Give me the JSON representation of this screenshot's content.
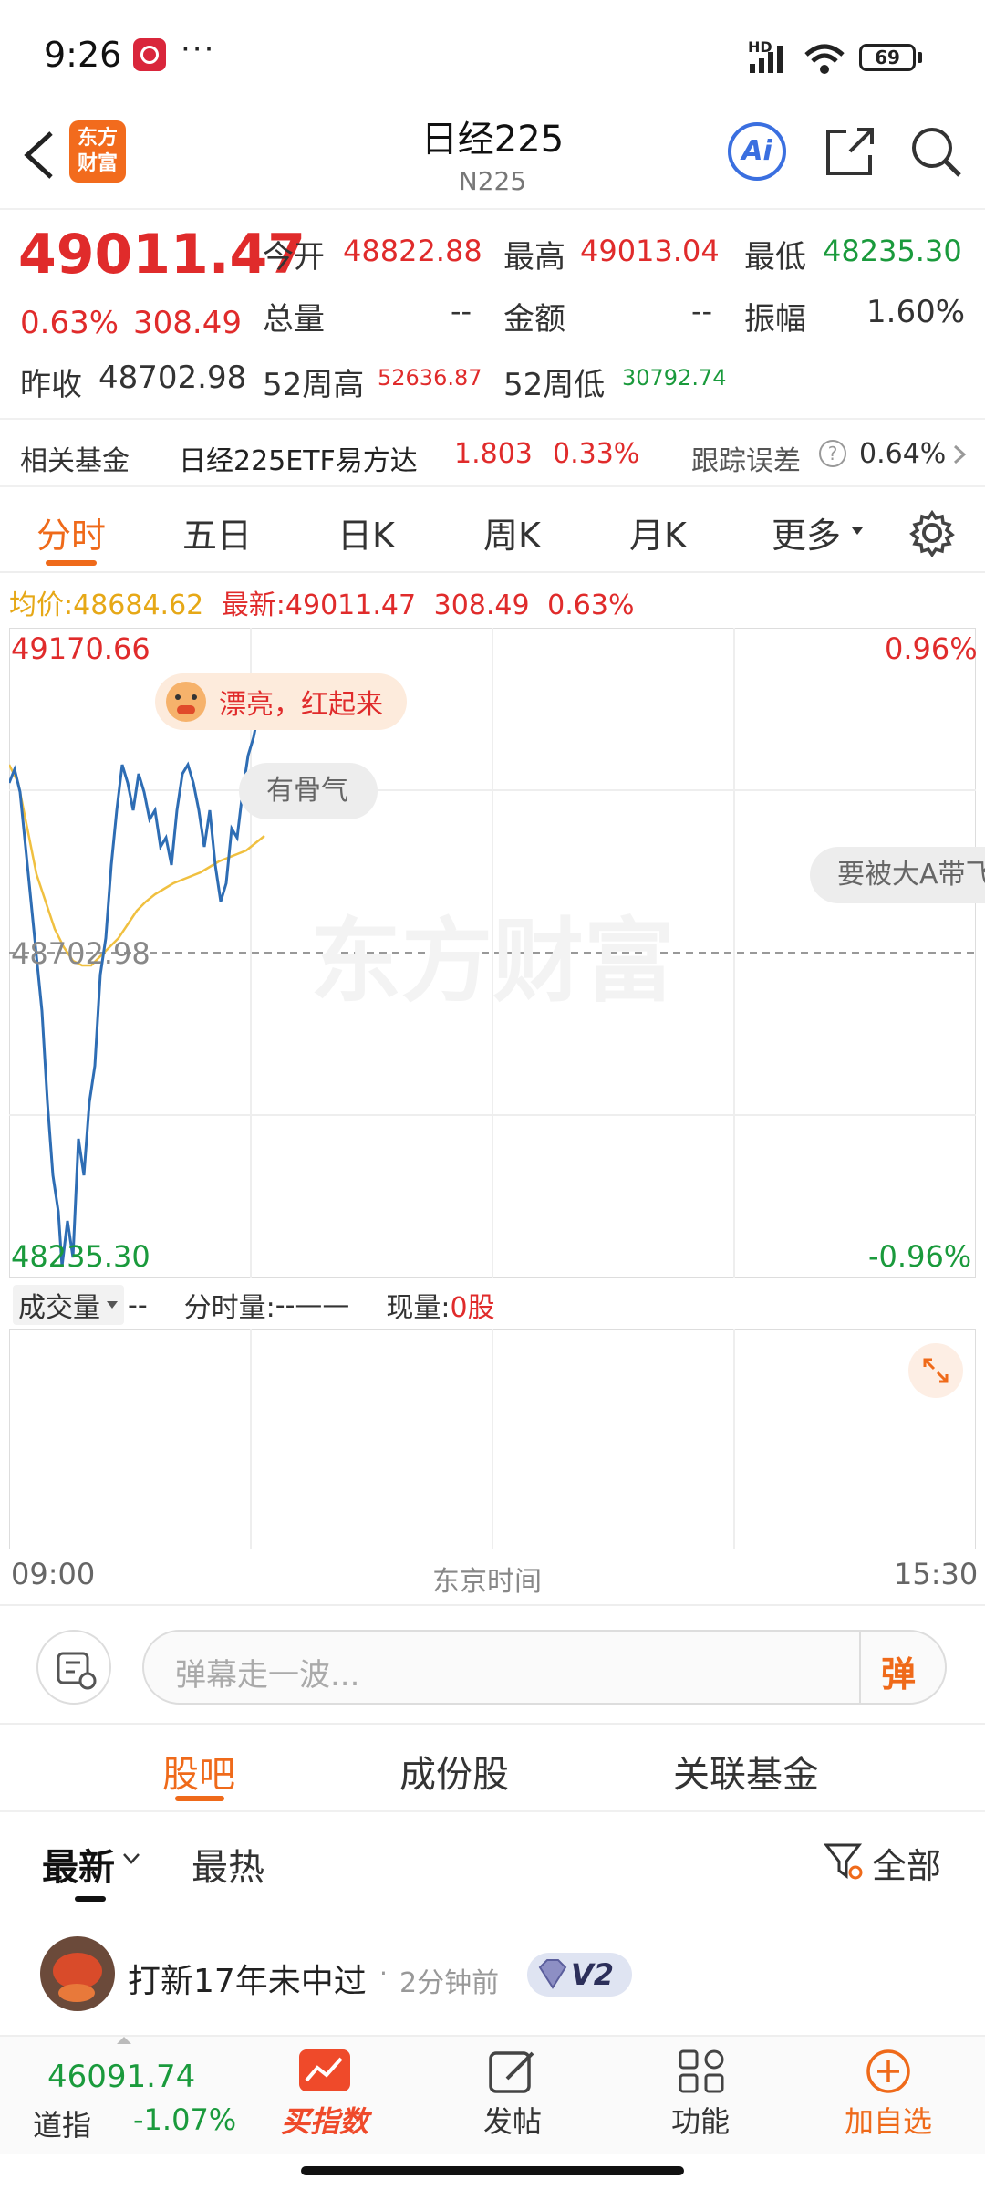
{
  "status_bar": {
    "time": "9:26",
    "dots": "···",
    "network": "HD",
    "battery": "69"
  },
  "header": {
    "title": "日经225",
    "subtitle": "N225",
    "logo_line1": "东方",
    "logo_line2": "财富",
    "ai_label": "Ai"
  },
  "quote": {
    "price": "49011.47",
    "change_pct": "0.63%",
    "change_abs": "308.49",
    "open_label": "今开",
    "open": "48822.88",
    "high_label": "最高",
    "high": "49013.04",
    "low_label": "最低",
    "low": "48235.30",
    "volume_label": "总量",
    "volume": "--",
    "amount_label": "金额",
    "amount": "--",
    "amplitude_label": "振幅",
    "amplitude": "1.60%",
    "prev_close_label": "昨收",
    "prev_close": "48702.98",
    "w52_high_label": "52周高",
    "w52_high": "52636.87",
    "w52_low_label": "52周低",
    "w52_low": "30792.74"
  },
  "fund": {
    "label": "相关基金",
    "name": "日经225ETF易方达",
    "price": "1.803",
    "pct": "0.33%",
    "tracking_label": "跟踪误差",
    "tracking_value": "0.64%"
  },
  "tabs": [
    "分时",
    "五日",
    "日K",
    "周K",
    "月K",
    "更多"
  ],
  "chart": {
    "avg_label": "均价:",
    "avg_value": "48684.62",
    "latest_label": "最新:",
    "latest_value": "49011.47",
    "latest_abs": "308.49",
    "latest_pct": "0.63%",
    "y_top": "49170.66",
    "y_mid": "48702.98",
    "y_bottom": "48235.30",
    "pct_top": "0.96%",
    "pct_bottom": "-0.96%",
    "watermark": "东方财富",
    "danmu1": "漂亮，红起来",
    "danmu2": "有骨气",
    "danmu3": "要被大A带飞",
    "volume_selector": "成交量",
    "volume_dash": "--",
    "minute_vol_label": "分时量:",
    "minute_vol_value": "--——",
    "cur_vol_label": "现量:",
    "cur_vol_value": "0股",
    "time_start": "09:00",
    "time_zone": "东京时间",
    "time_end": "15:30",
    "colors": {
      "price_line": "#2e6db4",
      "avg_line": "#f0c040",
      "up": "#e02b2b",
      "down": "#1a9a3c"
    }
  },
  "comment": {
    "placeholder": "弹幕走一波...",
    "send_label": "弹"
  },
  "subtabs": [
    "股吧",
    "成份股",
    "关联基金"
  ],
  "sort": {
    "latest": "最新",
    "hot": "最热",
    "filter": "全部"
  },
  "post": {
    "username": "打新17年未中过",
    "time": "2分钟前",
    "badge": "V2"
  },
  "bottom_nav": {
    "dow_value": "46091.74",
    "dow_label": "道指",
    "dow_pct": "-1.07%",
    "items": [
      "买指数",
      "发帖",
      "功能",
      "加自选"
    ]
  }
}
